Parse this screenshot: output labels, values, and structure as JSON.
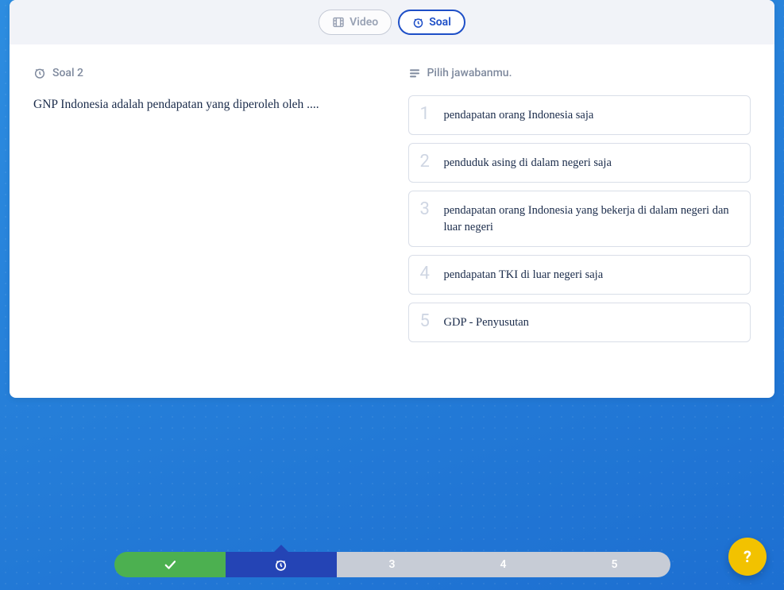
{
  "tabs": {
    "video": "Video",
    "soal": "Soal"
  },
  "question": {
    "label": "Soal 2",
    "text": "GNP Indonesia adalah pendapatan yang diperoleh oleh ...."
  },
  "answers": {
    "label": "Pilih jawabanmu.",
    "items": [
      {
        "num": "1",
        "text": "pendapatan orang Indonesia saja"
      },
      {
        "num": "2",
        "text": "penduduk asing di dalam negeri saja"
      },
      {
        "num": "3",
        "text": "pendapatan orang Indonesia yang bekerja di dalam negeri dan luar negeri"
      },
      {
        "num": "4",
        "text": "pendapatan TKI di luar negeri saja"
      },
      {
        "num": "5",
        "text": "GDP - Penyusutan"
      }
    ]
  },
  "progress": {
    "items": [
      {
        "state": "done"
      },
      {
        "state": "active"
      },
      {
        "state": "todo",
        "label": "3"
      },
      {
        "state": "todo",
        "label": "4"
      },
      {
        "state": "todo",
        "label": "5"
      }
    ]
  },
  "help": "?"
}
